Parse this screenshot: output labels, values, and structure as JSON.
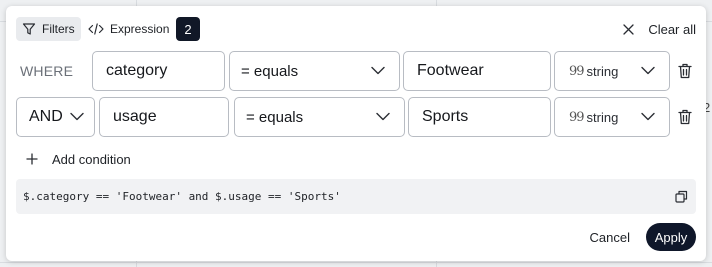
{
  "background": {
    "partial_number": "2"
  },
  "toolbar": {
    "filters_tab": {
      "label": "Filters",
      "icon": "filter-icon"
    },
    "expression_tab": {
      "label": "Expression",
      "icon": "code-icon"
    },
    "condition_count": "2",
    "clear_all": {
      "label": "Clear all",
      "icon": "close-icon"
    }
  },
  "conditions": [
    {
      "connector": "WHERE",
      "field": "category",
      "operator": "= equals",
      "value": "Footwear",
      "type": "string"
    },
    {
      "connector": "AND",
      "field": "usage",
      "operator": "= equals",
      "value": "Sports",
      "type": "string"
    }
  ],
  "type_quote_glyph": "99",
  "add_condition": {
    "label": "Add condition",
    "icon": "plus-icon"
  },
  "expression_preview": "$.category == 'Footwear' and $.usage == 'Sports'",
  "footer": {
    "cancel_label": "Cancel",
    "apply_label": "Apply"
  },
  "colors": {
    "primary": "#0f172a",
    "badge": "#111827",
    "border": "#b8bcc3",
    "preview_bg": "#f1f2f4"
  }
}
